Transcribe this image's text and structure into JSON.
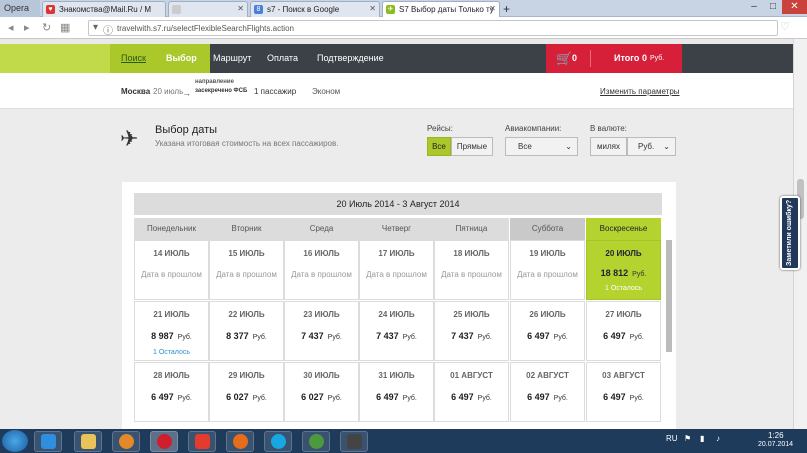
{
  "browser": {
    "opera_label": "Opera",
    "tabs": [
      {
        "label": "Знакомства@Mail.Ru / М"
      },
      {
        "label": ""
      },
      {
        "label": "s7 - Поиск в Google"
      },
      {
        "label": "S7 Выбор даты Только ту"
      }
    ],
    "new_tab": "+",
    "win_min": "–",
    "win_max": "□",
    "win_close": "✕",
    "url": "travelwith.s7.ru/selectFlexibleSearchFlights.action"
  },
  "nav": {
    "steps": [
      "Поиск",
      "Выбор",
      "Маршрут",
      "Оплата",
      "Подтверждение"
    ],
    "cart_count": "0",
    "total_label": "Итого",
    "total_value": "0",
    "total_currency": "Руб."
  },
  "summary": {
    "from": "Москва",
    "date": "20 июль",
    "direction_label": "направление",
    "destination": "засекречено ФСБ",
    "passengers": "1 пассажир",
    "class": "Эконом",
    "change_link": "Изменить параметры"
  },
  "page": {
    "title": "Выбор даты",
    "subtitle": "Указана итоговая стоимость на всех пассажиров.",
    "flights_label": "Рейсы:",
    "flights_options": [
      "Все",
      "Прямые"
    ],
    "airlines_label": "Авиакомпании:",
    "airlines_value": "Все",
    "currency_label": "В валюте:",
    "currency_options": [
      "милях",
      "Руб."
    ]
  },
  "calendar": {
    "range": "20 Июль 2014 - 3 Август 2014",
    "weekdays": [
      "Понедельник",
      "Вторник",
      "Среда",
      "Четверг",
      "Пятница",
      "Суббота",
      "Воскресенье"
    ],
    "rows": [
      [
        {
          "date": "14 ИЮЛЬ",
          "past": "Дата в прошлом"
        },
        {
          "date": "15 ИЮЛЬ",
          "past": "Дата в прошлом"
        },
        {
          "date": "16 ИЮЛЬ",
          "past": "Дата в прошлом"
        },
        {
          "date": "17 ИЮЛЬ",
          "past": "Дата в прошлом"
        },
        {
          "date": "18 ИЮЛЬ",
          "past": "Дата в прошлом"
        },
        {
          "date": "19 ИЮЛЬ",
          "past": "Дата в прошлом"
        },
        {
          "date": "20 ИЮЛЬ",
          "price": "18 812",
          "currency": "Руб.",
          "left": "1 Осталось"
        }
      ],
      [
        {
          "date": "21 ИЮЛЬ",
          "price": "8 987",
          "currency": "Руб.",
          "left": "1 Осталось"
        },
        {
          "date": "22 ИЮЛЬ",
          "price": "8 377",
          "currency": "Руб."
        },
        {
          "date": "23 ИЮЛЬ",
          "price": "7 437",
          "currency": "Руб."
        },
        {
          "date": "24 ИЮЛЬ",
          "price": "7 437",
          "currency": "Руб."
        },
        {
          "date": "25 ИЮЛЬ",
          "price": "7 437",
          "currency": "Руб."
        },
        {
          "date": "26 ИЮЛЬ",
          "price": "6 497",
          "currency": "Руб."
        },
        {
          "date": "27 ИЮЛЬ",
          "price": "6 497",
          "currency": "Руб."
        }
      ],
      [
        {
          "date": "28 ИЮЛЬ",
          "price": "6 497",
          "currency": "Руб."
        },
        {
          "date": "29 ИЮЛЬ",
          "price": "6 027",
          "currency": "Руб."
        },
        {
          "date": "30 ИЮЛЬ",
          "price": "6 027",
          "currency": "Руб."
        },
        {
          "date": "31 ИЮЛЬ",
          "price": "6 497",
          "currency": "Руб."
        },
        {
          "date": "01 АВГУСТ",
          "price": "6 497",
          "currency": "Руб."
        },
        {
          "date": "02 АВГУСТ",
          "price": "6 497",
          "currency": "Руб."
        },
        {
          "date": "03 АВГУСТ",
          "price": "6 497",
          "currency": "Руб."
        }
      ]
    ]
  },
  "feedback_label": "Заметили ошибку?",
  "taskbar": {
    "lang": "RU",
    "time": "1:26",
    "date": "20.07.2014"
  },
  "colors": {
    "accent_green": "#aac82a",
    "nav_dark": "#3c4147",
    "cart_red": "#d6203a",
    "link_blue": "#2a8fc9"
  }
}
